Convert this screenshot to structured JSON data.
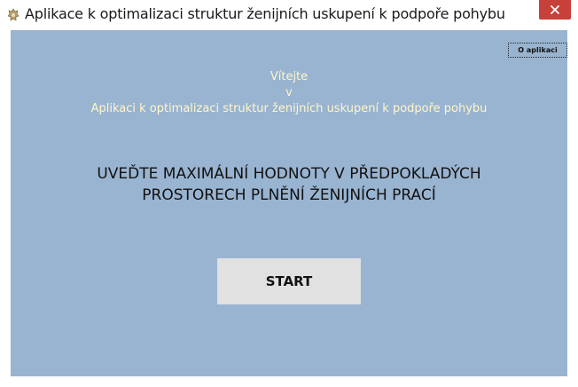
{
  "window": {
    "title": "Aplikace k optimalizaci struktur ženijních uskupení k podpoře pohybu",
    "close_icon": "close-icon",
    "app_icon": "app-crest-icon"
  },
  "header": {
    "about_label": "O aplikaci"
  },
  "welcome": {
    "line1": "Vítejte",
    "line2": "v",
    "line3": "Aplikaci k optimalizaci struktur ženijních uskupení k podpoře pohybu"
  },
  "instruction": {
    "line1": "UVEĎTE MAXIMÁLNÍ HODNOTY V PŘEDPOKLADÝCH",
    "line2": "PROSTORECH PLNĚNÍ ŽENIJNÍCH PRACÍ"
  },
  "actions": {
    "start_label": "START"
  },
  "colors": {
    "client_background": "#99b4d1",
    "welcome_text": "#fff6c8",
    "close_button": "#c7403a",
    "start_button": "#e1e1e1"
  }
}
